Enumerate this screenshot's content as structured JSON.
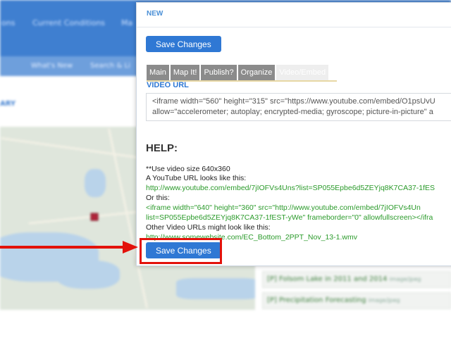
{
  "background": {
    "nav_items": [
      "ons",
      "Current Conditions",
      "Ma"
    ],
    "subnav_items": [
      "What's New",
      "Search & Li"
    ],
    "breadcrumb": "ARY",
    "list_items": [
      {
        "label": "[P] Folsom Lake in 2011 and 2014",
        "tag": "image/jpeg"
      },
      {
        "label": "[P] Precipitation Forecasting",
        "tag": "image/jpeg"
      }
    ],
    "nav_color": "#3f7fd0"
  },
  "dialog": {
    "title": "NEW",
    "save_label": "Save Changes",
    "tabs": [
      {
        "label": "Main",
        "active": false
      },
      {
        "label": "Map It!",
        "active": false
      },
      {
        "label": "Publish?",
        "active": false
      },
      {
        "label": "Organize",
        "active": false
      },
      {
        "label": "Video/Embed",
        "active": true
      }
    ],
    "video_url_label": "VIDEO URL",
    "video_url_lines": [
      "<iframe width=\"560\" height=\"315\" src=\"https://www.youtube.com/embed/O1psUvU",
      "allow=\"accelerometer; autoplay; encrypted-media; gyroscope; picture-in-picture\" a"
    ],
    "help_title": "HELP:",
    "help_lines": [
      {
        "text": "**Use video size 640x360",
        "style": "dark"
      },
      {
        "text": "A YouTube URL looks like this:",
        "style": "dark"
      },
      {
        "text": "http://www.youtube.com/embed/7jIOFVs4Uns?list=SP055Epbe6d5ZEYjq8K7CA37-1fES",
        "style": "green"
      },
      {
        "text": "Or this:",
        "style": "dark"
      },
      {
        "text": "<iframe width=\"640\" height=\"360\" src=\"http://www.youtube.com/embed/7jIOFVs4Un",
        "style": "green"
      },
      {
        "text": "list=SP055Epbe6d5ZEYjq8K7CA37-1fEST-yWe\" frameborder=\"0\" allowfullscreen></ifra",
        "style": "green"
      },
      {
        "text": "Other Video URLs might look like this:",
        "style": "dark"
      },
      {
        "text": "http://www.somewebsite.com/EC_Bottom_2PPT_Nov_13-1.wmv",
        "style": "green"
      }
    ],
    "accent_color": "#2f78d4",
    "highlight_color": "#e3120b"
  }
}
